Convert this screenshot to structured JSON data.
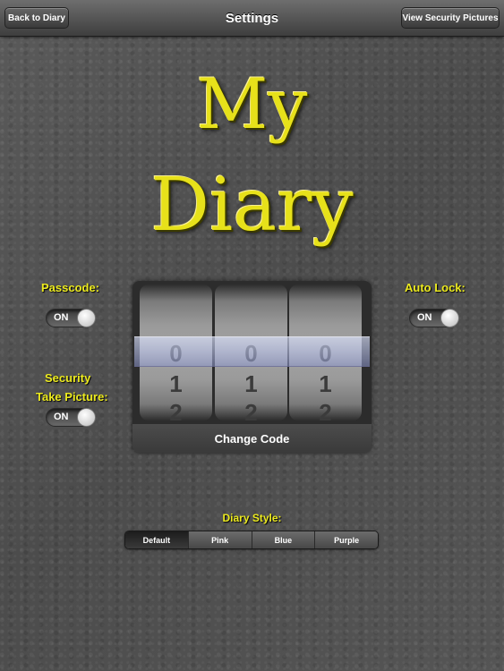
{
  "nav": {
    "title": "Settings",
    "back_label": "Back to Diary",
    "view_security_label": "View Security Pictures"
  },
  "app_title": {
    "line1": "My",
    "line2": "Diary"
  },
  "passcode": {
    "label": "Passcode:",
    "toggle_text": "ON",
    "state": "on"
  },
  "auto_lock": {
    "label": "Auto Lock:",
    "toggle_text": "ON",
    "state": "on"
  },
  "security": {
    "label": "Security",
    "take_picture_label": "Take Picture:",
    "toggle_text": "ON",
    "state": "on"
  },
  "code_lock": {
    "wheels": [
      {
        "digits": [
          "0",
          "1",
          "2"
        ]
      },
      {
        "digits": [
          "0",
          "1",
          "2"
        ]
      },
      {
        "digits": [
          "0",
          "1",
          "2"
        ]
      }
    ],
    "change_code_label": "Change Code"
  },
  "diary_style": {
    "label": "Diary Style:",
    "options": [
      "Default",
      "Pink",
      "Blue",
      "Purple"
    ],
    "selected": "Default"
  },
  "colors": {
    "accent_yellow": "#e7e11a",
    "background": "#535353"
  }
}
